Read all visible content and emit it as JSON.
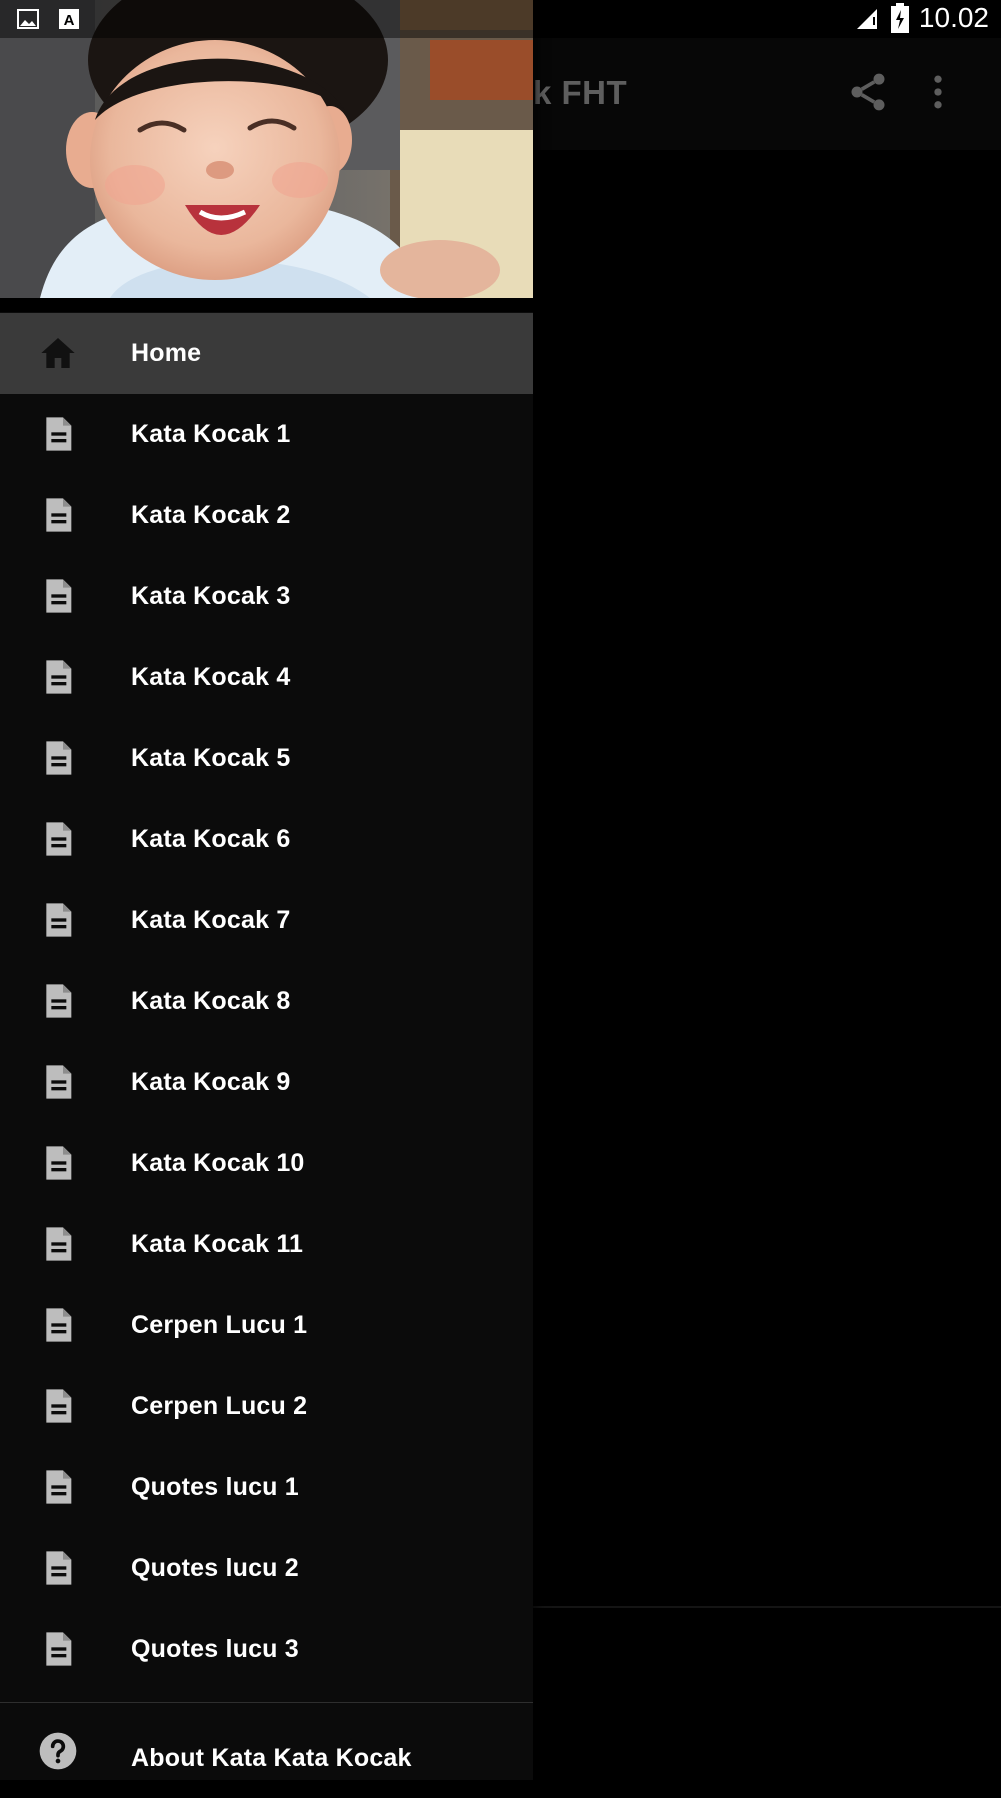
{
  "status_bar": {
    "time": "10.02",
    "icons": [
      "gallery-icon",
      "keyboard-a-icon",
      "signal-icon",
      "battery-charging-icon"
    ]
  },
  "app_bar": {
    "title_visible": "k FHT",
    "actions": [
      "share-icon",
      "more-vert-icon"
    ]
  },
  "drawer": {
    "menu": [
      {
        "label": "Home",
        "icon": "home-icon",
        "selected": true
      },
      {
        "label": "Kata Kocak 1",
        "icon": "document-icon"
      },
      {
        "label": "Kata Kocak 2",
        "icon": "document-icon"
      },
      {
        "label": "Kata Kocak 3",
        "icon": "document-icon"
      },
      {
        "label": "Kata Kocak 4",
        "icon": "document-icon"
      },
      {
        "label": "Kata Kocak 5",
        "icon": "document-icon"
      },
      {
        "label": "Kata Kocak 6",
        "icon": "document-icon"
      },
      {
        "label": "Kata Kocak 7",
        "icon": "document-icon"
      },
      {
        "label": "Kata Kocak 8",
        "icon": "document-icon"
      },
      {
        "label": "Kata Kocak 9",
        "icon": "document-icon"
      },
      {
        "label": "Kata Kocak 10",
        "icon": "document-icon"
      },
      {
        "label": "Kata Kocak 11",
        "icon": "document-icon"
      },
      {
        "label": "Cerpen Lucu 1",
        "icon": "document-icon"
      },
      {
        "label": "Cerpen Lucu 2",
        "icon": "document-icon"
      },
      {
        "label": "Quotes lucu 1",
        "icon": "document-icon"
      },
      {
        "label": "Quotes lucu 2",
        "icon": "document-icon"
      },
      {
        "label": "Quotes lucu 3",
        "icon": "document-icon"
      }
    ],
    "about": {
      "label": "About Kata Kata Kocak",
      "icon": "help-circle-icon"
    }
  },
  "colors": {
    "drawer_bg": "#0b0b0b",
    "selected_bg": "#3a3a3a",
    "icon_gray": "#bdbdbd",
    "text": "#ffffff"
  }
}
